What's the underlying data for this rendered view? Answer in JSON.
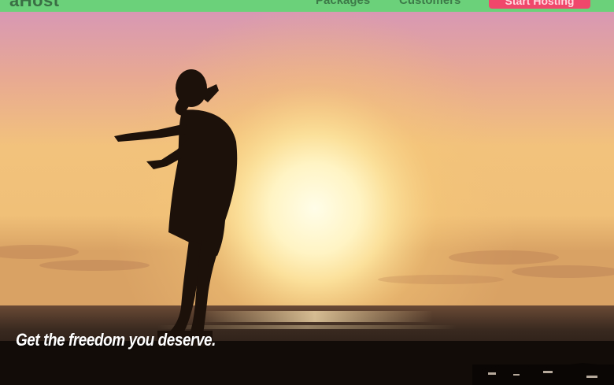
{
  "navbar": {
    "logo": "aHost",
    "links": [
      {
        "label": "Packages"
      },
      {
        "label": "Customers"
      }
    ],
    "cta_label": "Start Hosting",
    "bg_color": "#6bd17a",
    "cta_color": "#f0476b"
  },
  "hero": {
    "image": "silhouette-woman-sunset-beach",
    "tagline": "Get the freedom you deserve."
  }
}
